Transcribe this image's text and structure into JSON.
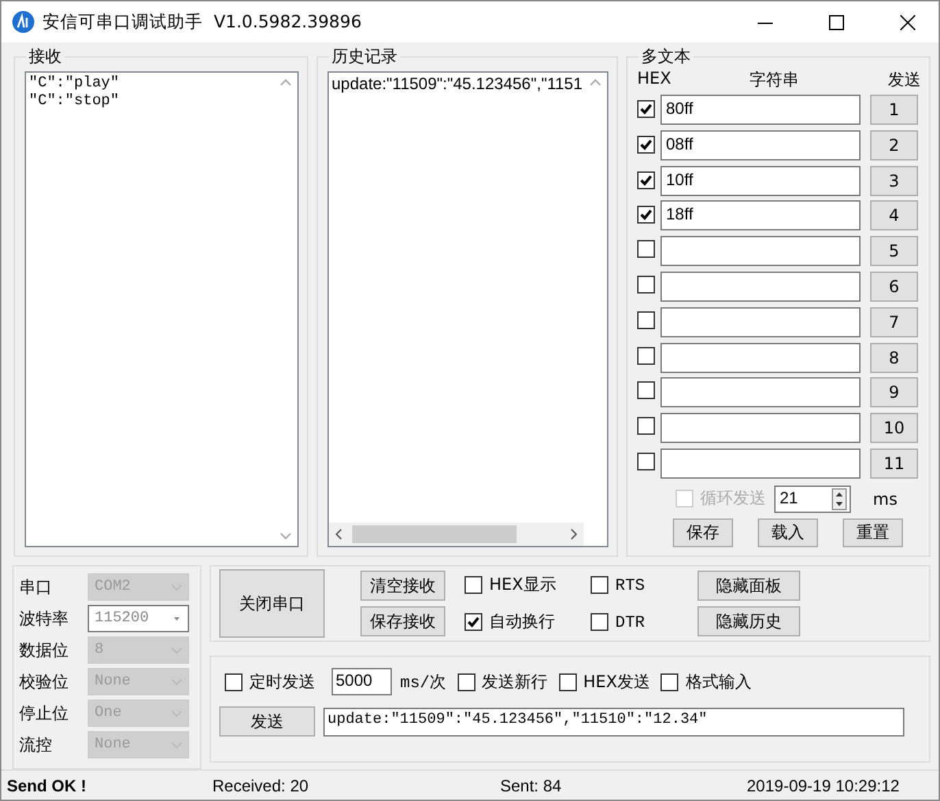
{
  "window": {
    "title": "安信可串口调试助手  V1.0.5982.39896"
  },
  "receive": {
    "title": "接收",
    "lines": [
      "\"C\":\"play\"",
      "\"C\":\"stop\""
    ]
  },
  "history": {
    "title": "历史记录",
    "lines": [
      "update:\"11509\":\"45.123456\",\"1151"
    ]
  },
  "multi_text": {
    "title": "多文本",
    "headers": [
      "HEX",
      "字符串",
      "发送"
    ],
    "rows": [
      {
        "hex": true,
        "value": "80ff",
        "button": "1"
      },
      {
        "hex": true,
        "value": "08ff",
        "button": "2"
      },
      {
        "hex": true,
        "value": "10ff",
        "button": "3"
      },
      {
        "hex": true,
        "value": "18ff",
        "button": "4"
      },
      {
        "hex": false,
        "value": "",
        "button": "5"
      },
      {
        "hex": false,
        "value": "",
        "button": "6"
      },
      {
        "hex": false,
        "value": "",
        "button": "7"
      },
      {
        "hex": false,
        "value": "",
        "button": "8"
      },
      {
        "hex": false,
        "value": "",
        "button": "9"
      },
      {
        "hex": false,
        "value": "",
        "button": "10"
      },
      {
        "hex": false,
        "value": "",
        "button": "11"
      }
    ],
    "loop": {
      "label": "循环发送",
      "checked": false,
      "disabled": true,
      "interval": "21",
      "unit": "ms"
    },
    "buttons": [
      "保存",
      "载入",
      "重置"
    ]
  },
  "port_settings": [
    {
      "label": "串口",
      "value": "COM2",
      "disabled": true
    },
    {
      "label": "波特率",
      "value": "115200",
      "disabled": false
    },
    {
      "label": "数据位",
      "value": "8",
      "disabled": true
    },
    {
      "label": "校验位",
      "value": "None",
      "disabled": true
    },
    {
      "label": "停止位",
      "value": "One",
      "disabled": true
    },
    {
      "label": "流控",
      "value": "None",
      "disabled": true
    }
  ],
  "controls": {
    "open_button": "关闭串口",
    "buttons": [
      "清空接收",
      "保存接收"
    ],
    "options": [
      {
        "label": "HEX显示",
        "checked": false
      },
      {
        "label": "RTS",
        "checked": false
      },
      {
        "label": "自动换行",
        "checked": true
      },
      {
        "label": "DTR",
        "checked": false
      }
    ],
    "panel_buttons": [
      "隐藏面板",
      "隐藏历史"
    ]
  },
  "send": {
    "timer": {
      "label": "定时发送",
      "checked": false
    },
    "interval": "5000",
    "unit": "ms/次",
    "options": [
      {
        "label": "发送新行",
        "checked": false
      },
      {
        "label": "HEX发送",
        "checked": false
      },
      {
        "label": "格式输入",
        "checked": false
      }
    ],
    "send_button": "发送",
    "input": "update:\"11509\":\"45.123456\",\"11510\":\"12.34\""
  },
  "status_bar": {
    "message": "Send OK !",
    "received": "Received: 20",
    "sent": "Sent: 84",
    "time": "2019-09-19 10:29:12"
  }
}
